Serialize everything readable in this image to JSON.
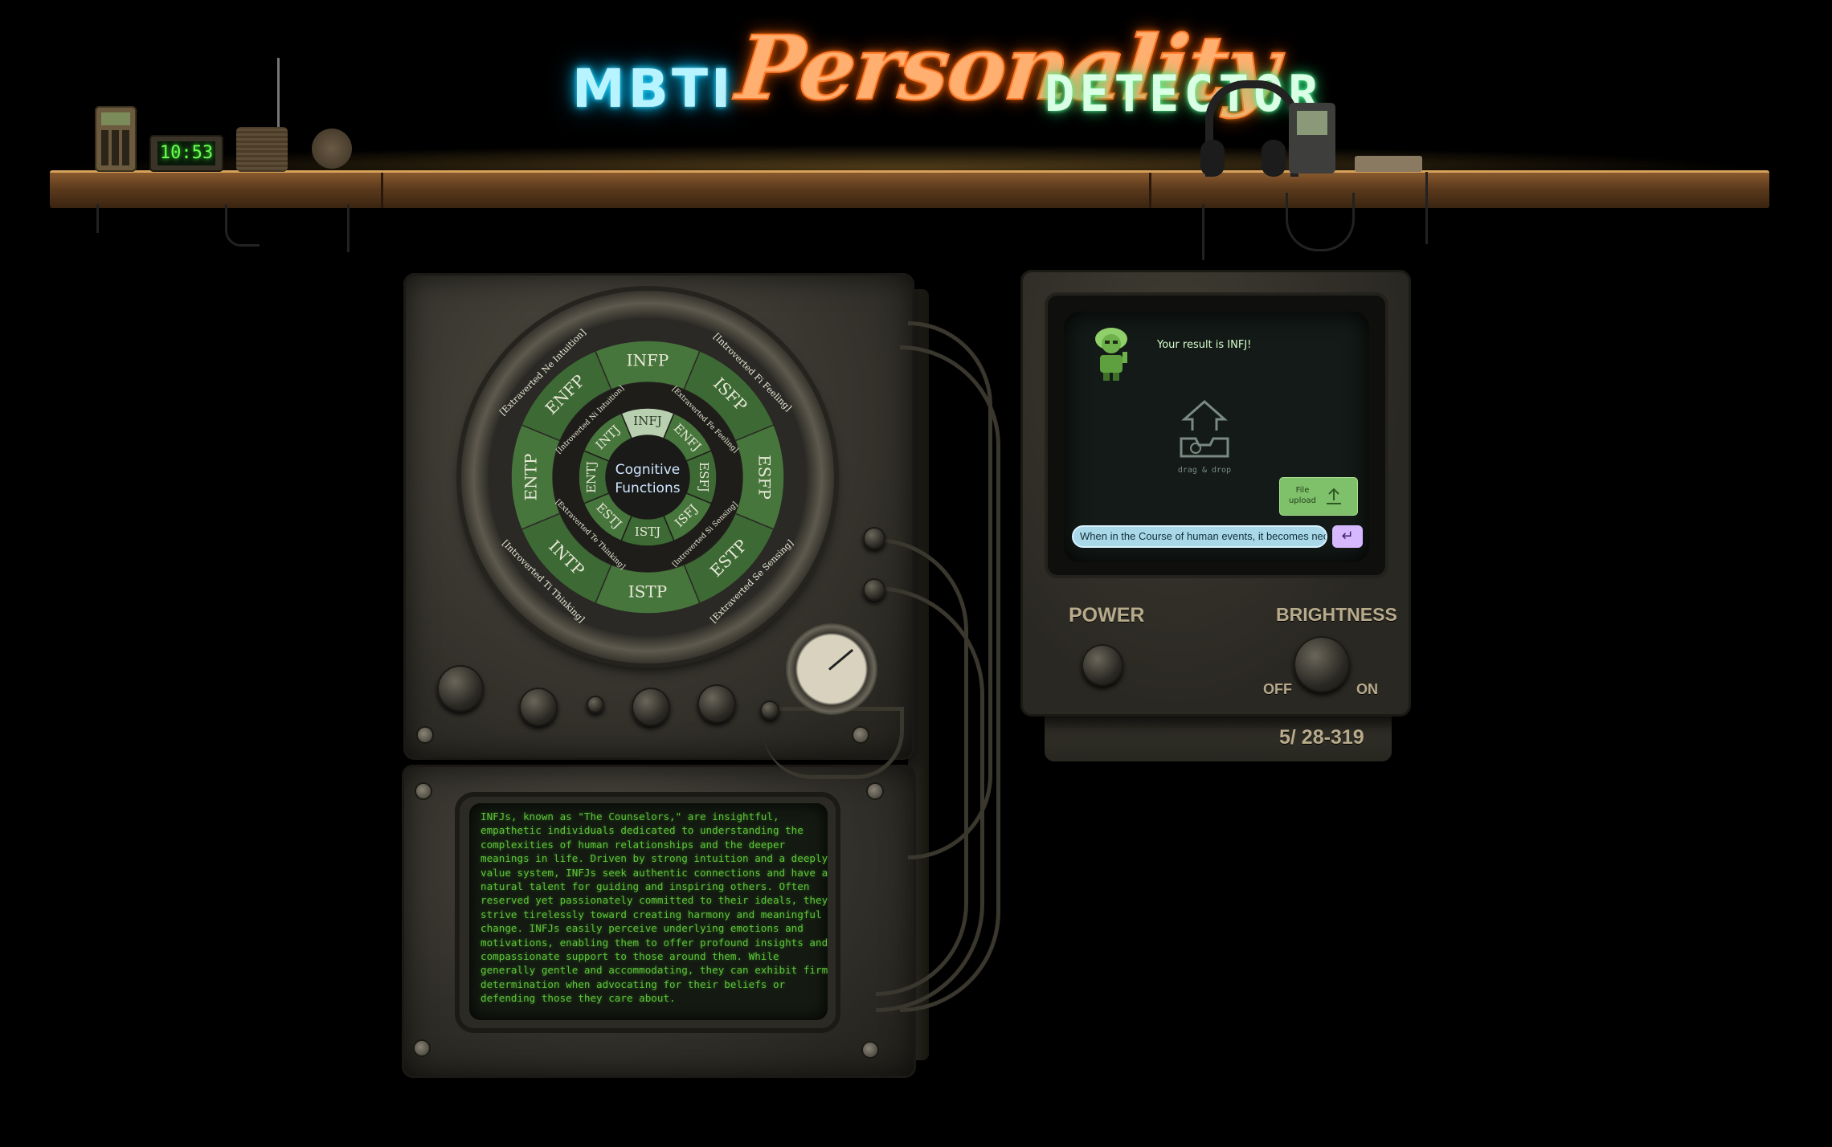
{
  "header": {
    "title_mbti": "MBTI",
    "title_personality": "Personality",
    "title_detector": "DETECTOR"
  },
  "shelf": {
    "clock_time": "10:53"
  },
  "wheel": {
    "center_label_line1": "Cognitive",
    "center_label_line2": "Functions",
    "selected_type": "INFJ",
    "outer_types": [
      "ENFP",
      "INFP",
      "ISFP",
      "ESFP",
      "ESTP",
      "ISTP",
      "INTP",
      "ENTP"
    ],
    "inner_types": [
      "INFJ",
      "ENFJ",
      "ESFJ",
      "ISFJ",
      "ISTJ",
      "ESTJ",
      "ENTJ",
      "INTJ"
    ],
    "outer_functions": [
      "[Extraverted Ne Intuition]",
      "[Introverted Fi Feeling]",
      "[Extraverted Se Sensing]",
      "[Introverted Ti Thinking]"
    ],
    "inner_functions": [
      "[Introverted Ni Intuition]",
      "[Extraverted Fe Feeling]",
      "[Introverted Si Sensing]",
      "[Extraverted Te Thinking]"
    ],
    "colors": {
      "ring": "#3d6a34",
      "ring_alt": "#47763c",
      "highlight": "#b9d0b0",
      "text": "#e8e8d8"
    }
  },
  "description": {
    "text": "INFJs, known as \"The Counselors,\" are insightful,\nempathetic individuals dedicated to understanding the\ncomplexities of human relationships and the deeper\nmeanings in life. Driven by strong intuition and a deeply held\nvalue system, INFJs seek authentic connections and have a\nnatural talent for guiding and inspiring others. Often\nreserved yet passionately committed to their ideals, they\nstrive tirelessly toward creating harmony and meaningful\nchange. INFJs easily perceive underlying emotions and\nmotivations, enabling them to offer profound insights and\ncompassionate support to those around them. While\ngenerally gentle and accommodating, they can exhibit firm\ndetermination when advocating for their beliefs or\ndefending those they care about."
  },
  "monitor": {
    "result_text": "Your result is INFJ!",
    "drag_drop": "drag & drop",
    "file_upload_label": "File upload",
    "input_value": "When in the Course of human events, it becomes necessary for one people to dissolve the political bands",
    "send_icon": "return-arrow-icon",
    "power_label": "POWER",
    "brightness_label": "BRIGHTNESS",
    "off_label": "OFF",
    "on_label": "ON",
    "serial": "5/ 28-319"
  }
}
